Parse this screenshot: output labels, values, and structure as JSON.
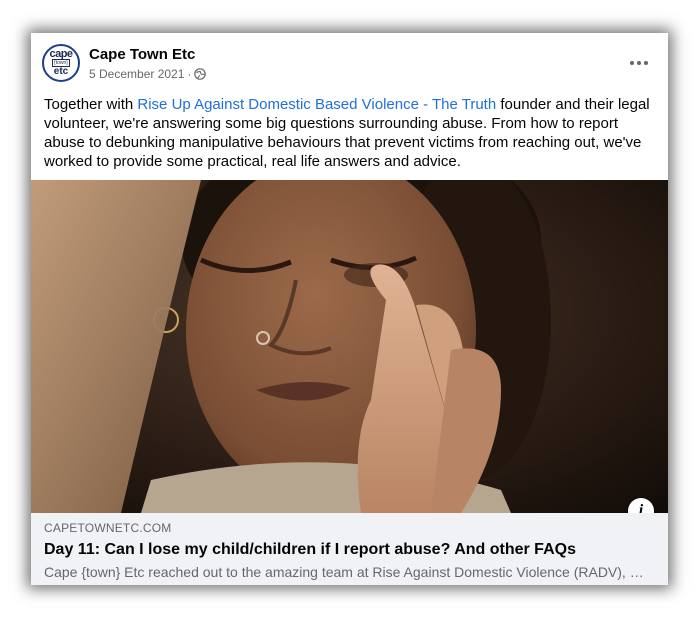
{
  "post": {
    "page_name": "Cape Town Etc",
    "avatar_text": [
      "cape",
      "{town}",
      "etc"
    ],
    "date": "5 December 2021",
    "separator": "·",
    "privacy_icon": "globe-icon",
    "more_icon": "more-options-icon",
    "text_before_link": "Together with ",
    "link_text": "Rise Up Against Domestic Based Violence - The Truth",
    "text_after_link": " founder and their legal volunteer, we're answering some big questions surrounding abuse. From how to report abuse to debunking manipulative behaviours that prevent victims from reaching out, we've worked to provide some practical, real life answers and advice."
  },
  "link_preview": {
    "domain": "CAPETOWNETC.COM",
    "title": "Day 11: Can I lose my child/children if I report abuse? And other FAQs",
    "description": "Cape {town} Etc reached out to the amazing team at Rise Against Domestic Violence (RADV), a...",
    "info_icon": "info-icon",
    "info_glyph": "i"
  },
  "colors": {
    "link_blue": "#216fdb",
    "text": "#050505",
    "muted": "#65676b",
    "preview_bg": "#f0f2f5"
  }
}
